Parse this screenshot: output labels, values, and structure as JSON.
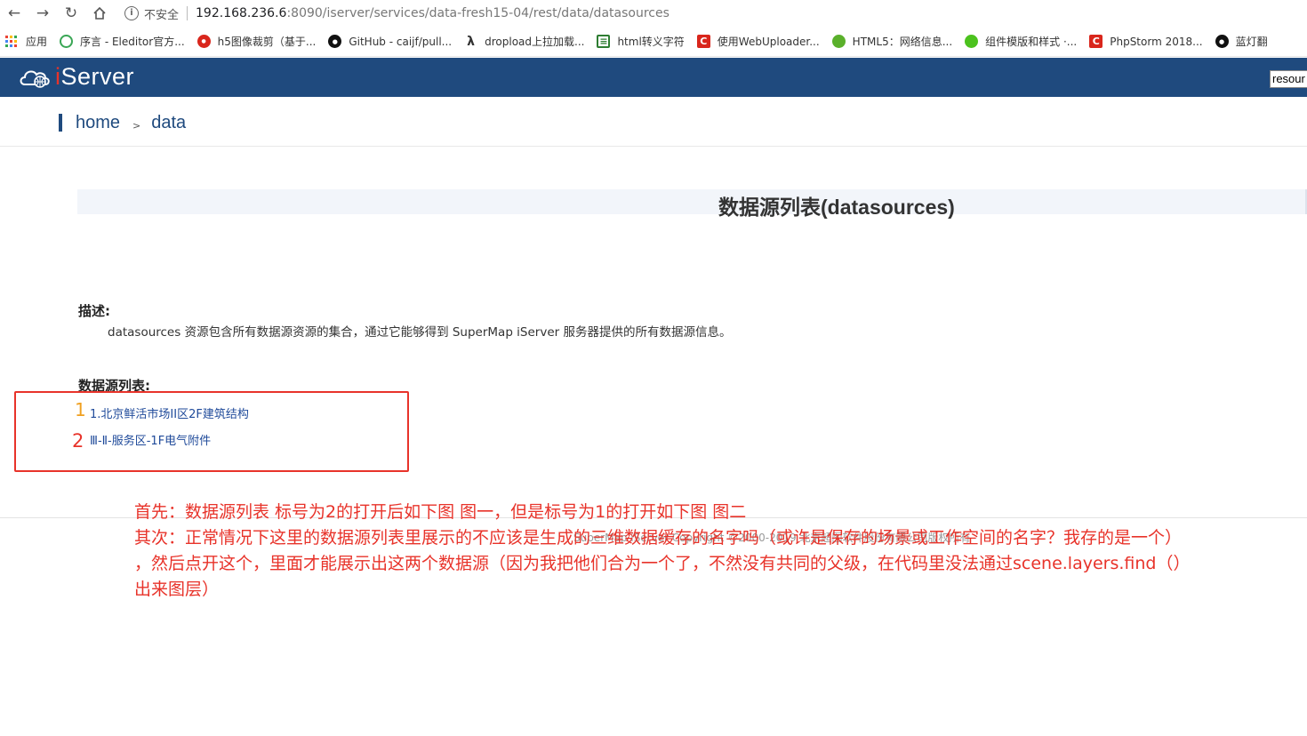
{
  "browser": {
    "insecure_label": "不安全",
    "url_host": "192.168.236.6",
    "url_rest": ":8090/iserver/services/data-fresh15-04/rest/data/datasources",
    "bookmarks": [
      {
        "label": "应用",
        "icon": "apps-grid-icon"
      },
      {
        "label": "序言 - Eleditor官方...",
        "icon": "eleditor-icon",
        "color": "#3aa655"
      },
      {
        "label": "h5图像裁剪（基于...",
        "icon": "h5-crop-icon",
        "color": "#d9261c"
      },
      {
        "label": "GitHub - caijf/pull...",
        "icon": "github-icon",
        "color": "#111111"
      },
      {
        "label": "dropload上拉加载...",
        "icon": "dropload-icon",
        "color": "#333333"
      },
      {
        "label": "html转义字符",
        "icon": "html-escape-icon",
        "color": "#2e7d32"
      },
      {
        "label": "使用WebUploader...",
        "icon": "csdn-icon",
        "color": "#d9261c"
      },
      {
        "label": "HTML5：网络信息...",
        "icon": "leaf-icon",
        "color": "#5ab02b"
      },
      {
        "label": "组件模版和样式 ·...",
        "icon": "wechat-icon",
        "color": "#4cc21e"
      },
      {
        "label": "PhpStorm 2018...",
        "icon": "csdn-icon",
        "color": "#d9261c"
      },
      {
        "label": "蓝灯翻",
        "icon": "github-icon",
        "color": "#111111"
      }
    ]
  },
  "header": {
    "logo_i": "i",
    "logo_server": "Server",
    "search_value": "resour"
  },
  "breadcrumb": {
    "home": "home",
    "sep": ">",
    "current": "data"
  },
  "page": {
    "title": "数据源列表(datasources)",
    "desc_heading": "描述:",
    "desc_text": "datasources 资源包含所有数据源资源的集合，通过它能够得到 SuperMap iServer 服务器提供的所有数据源信息。",
    "list_heading": "数据源列表:",
    "datasources": [
      "1.北京鲜活市场II区2F建筑结构",
      "Ⅲ-Ⅱ-服务区-1F电气附件"
    ],
    "ghost_text": "SuperMap  iServer  Copyright  ©2000-2019  北京超图软件股份有限公司版权所有"
  },
  "annotation": {
    "num1": "1",
    "num2": "2",
    "line1": "首先：数据源列表 标号为2的打开后如下图 图一，但是标号为1的打开如下图 图二",
    "line2": "其次：正常情况下这里的数据源列表里展示的不应该是生成的三维数据缓存的名字吗（或许是保存的场景或工作空间的名字？我存的是一个）",
    "line3": "，然后点开这个，里面才能展示出这两个数据源（因为我把他们合为一个了，不然没有共同的父级，在代码里没法通过scene.layers.find（）",
    "line4": "出来图层）",
    "color_red": "#e8332a",
    "color_orange": "#f0a020"
  }
}
